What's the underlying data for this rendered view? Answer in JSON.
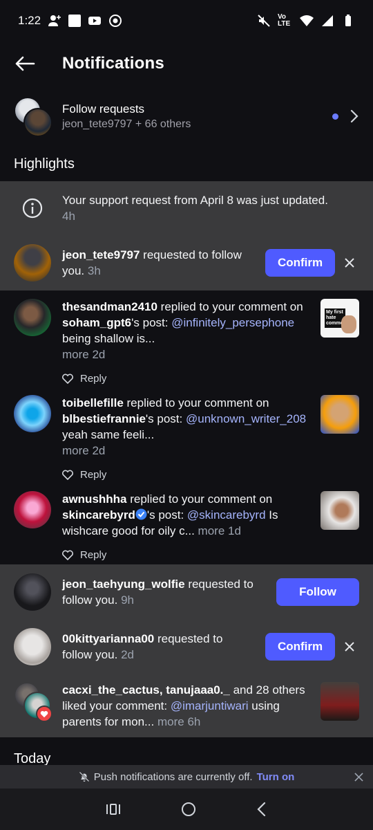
{
  "status": {
    "time": "1:22",
    "network": "Vo LTE"
  },
  "header": {
    "title": "Notifications"
  },
  "follow_requests": {
    "title": "Follow requests",
    "subtitle": "jeon_tete9797 + 66 others"
  },
  "sections": {
    "highlights": "Highlights",
    "today": "Today"
  },
  "support": {
    "text": "Your support request from April 8 was just updated.",
    "time": "4h"
  },
  "n1": {
    "user": "jeon_tete9797",
    "text": " requested to follow you.",
    "time": "3h",
    "button": "Confirm"
  },
  "n2": {
    "user": "thesandman2410",
    "text1": " replied to your comment on ",
    "post_user": "soham_gpt6",
    "text2": "'s post: ",
    "mention": "@infinitely_persephone",
    "text3": " being shallow is...",
    "more": "more",
    "time": "2d",
    "reply": "Reply",
    "thumb_text": "My first hate comment"
  },
  "n3": {
    "user": "toibellefille",
    "text1": " replied to your comment on ",
    "post_user": "blbestiefrannie",
    "text2": "'s post: ",
    "mention": "@unknown_writer_208",
    "text3": " yeah same feeli...",
    "more": "more",
    "time": "2d",
    "reply": "Reply"
  },
  "n4": {
    "user": "awnushhha",
    "text1": " replied to your comment on ",
    "post_user": "skincarebyrd",
    "text2": "'s post: ",
    "mention": "@skincarebyrd",
    "text3": " Is wishcare good for oily c...",
    "more": "more",
    "time": "1d",
    "reply": "Reply"
  },
  "n5": {
    "user": "jeon_taehyung_wolfie",
    "text": " requested to follow you.",
    "time": "9h",
    "button": "Follow"
  },
  "n6": {
    "user": "00kittyarianna00",
    "text": " requested to follow you.",
    "time": "2d",
    "button": "Confirm"
  },
  "n7": {
    "users": "cacxi_the_cactus, tanujaaa0._",
    "text1": " and 28 others liked your comment: ",
    "mention": "@imarjuntiwari",
    "text2": " using parents for mon...",
    "more": "more",
    "time": "6h"
  },
  "push": {
    "text": "Push notifications are currently off.",
    "action": "Turn on"
  },
  "colors": {
    "accent": "#4f5bff",
    "background": "#101014",
    "highlight": "#3a3a3c",
    "mention": "#a5b4fc"
  }
}
